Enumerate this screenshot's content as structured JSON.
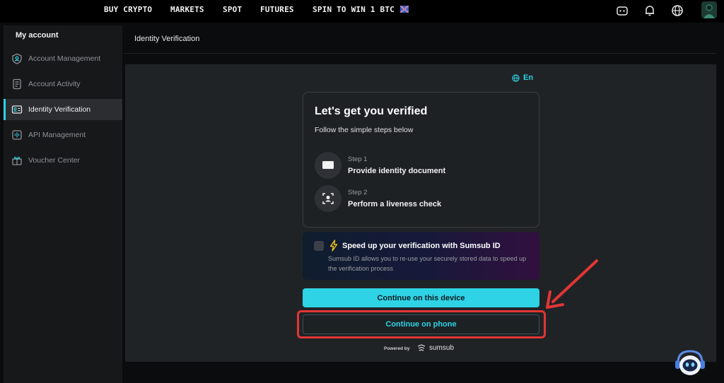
{
  "topnav": {
    "items": [
      "BUY CRYPTO",
      "MARKETS",
      "SPOT",
      "FUTURES",
      "SPIN TO WIN 1 BTC"
    ],
    "icons": [
      "support-icon",
      "bell-icon",
      "globe-icon",
      "avatar"
    ]
  },
  "sidebar": {
    "title": "My account",
    "items": [
      {
        "label": "Account Management",
        "icon": "shield-user-icon",
        "active": false
      },
      {
        "label": "Account Activity",
        "icon": "document-list-icon",
        "active": false
      },
      {
        "label": "Identity Verification",
        "icon": "id-card-icon",
        "active": true
      },
      {
        "label": "API Management",
        "icon": "api-icon",
        "active": false
      },
      {
        "label": "Voucher Center",
        "icon": "gift-icon",
        "active": false
      }
    ]
  },
  "main": {
    "title": "Identity Verification"
  },
  "widget": {
    "language": "En",
    "card_title": "Let's get you verified",
    "card_subtitle": "Follow the simple steps below",
    "steps": [
      {
        "number": "Step 1",
        "text": "Provide identity document",
        "icon": "id-document-icon"
      },
      {
        "number": "Step 2",
        "text": "Perform a liveness check",
        "icon": "face-scan-icon"
      }
    ],
    "promo_title": "Speed up your verification with Sumsub ID",
    "promo_desc": "Sumsub ID allows you to re-use your securely stored data to speed up the verification process",
    "continue_device": "Continue on this device",
    "continue_phone": "Continue on phone",
    "powered_by": "Powered by",
    "brand": "sumsub"
  },
  "colors": {
    "accent": "#2ed3e6",
    "highlight": "#e23535",
    "panel": "#202326",
    "sidebar": "#17181a"
  }
}
